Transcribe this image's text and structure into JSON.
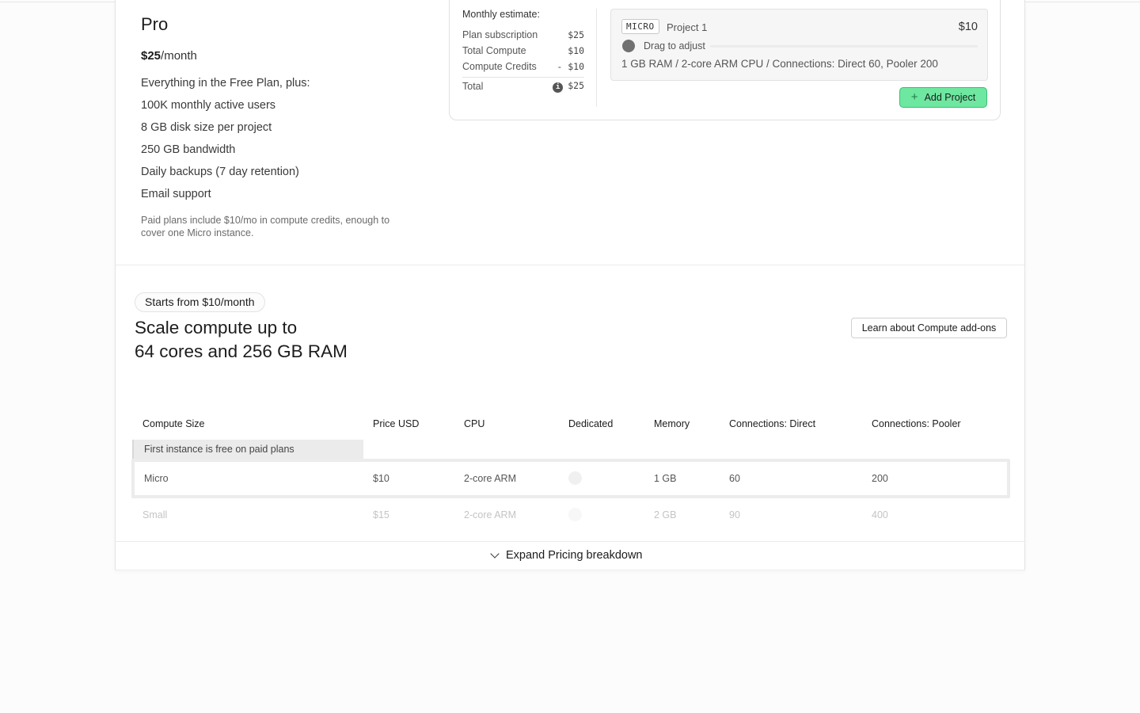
{
  "plan": {
    "name": "Pro",
    "price": "$25",
    "price_suffix": "/month",
    "features": [
      "Everything in the Free Plan, plus:",
      "100K monthly active users",
      "8 GB disk size per project",
      "250 GB bandwidth",
      "Daily backups (7 day retention)",
      "Email support"
    ],
    "note": "Paid plans include $10/mo in compute credits, enough to cover one Micro instance."
  },
  "estimate": {
    "title": "Monthly estimate:",
    "rows": [
      {
        "label": "Plan subscription",
        "value": "$25"
      },
      {
        "label": "Total Compute",
        "value": "$10"
      },
      {
        "label": "Compute Credits",
        "value": "- $10"
      }
    ],
    "total_label": "Total",
    "total_value": "$25"
  },
  "project": {
    "badge": "MICRO",
    "name": "Project 1",
    "price": "$10",
    "slider_label": "Drag to adjust",
    "spec": "1 GB RAM / 2-core ARM CPU / Connections: Direct 60, Pooler 200",
    "add_label": "Add Project"
  },
  "compute": {
    "pill": "Starts from $10/month",
    "headline_line1": "Scale compute up to",
    "headline_line2": "64 cores and 256 GB RAM",
    "learn_label": "Learn about Compute add-ons",
    "free_tag": "First instance is free on paid plans",
    "columns": [
      "Compute Size",
      "Price USD",
      "CPU",
      "Dedicated",
      "Memory",
      "Connections: Direct",
      "Connections: Pooler"
    ],
    "rows": [
      {
        "size": "Micro",
        "price": "$10",
        "cpu": "2-core ARM",
        "memory": "1 GB",
        "direct": "60",
        "pooler": "200"
      },
      {
        "size": "Small",
        "price": "$15",
        "cpu": "2-core ARM",
        "memory": "2 GB",
        "direct": "90",
        "pooler": "400"
      }
    ],
    "expand_label": "Expand Pricing breakdown"
  }
}
